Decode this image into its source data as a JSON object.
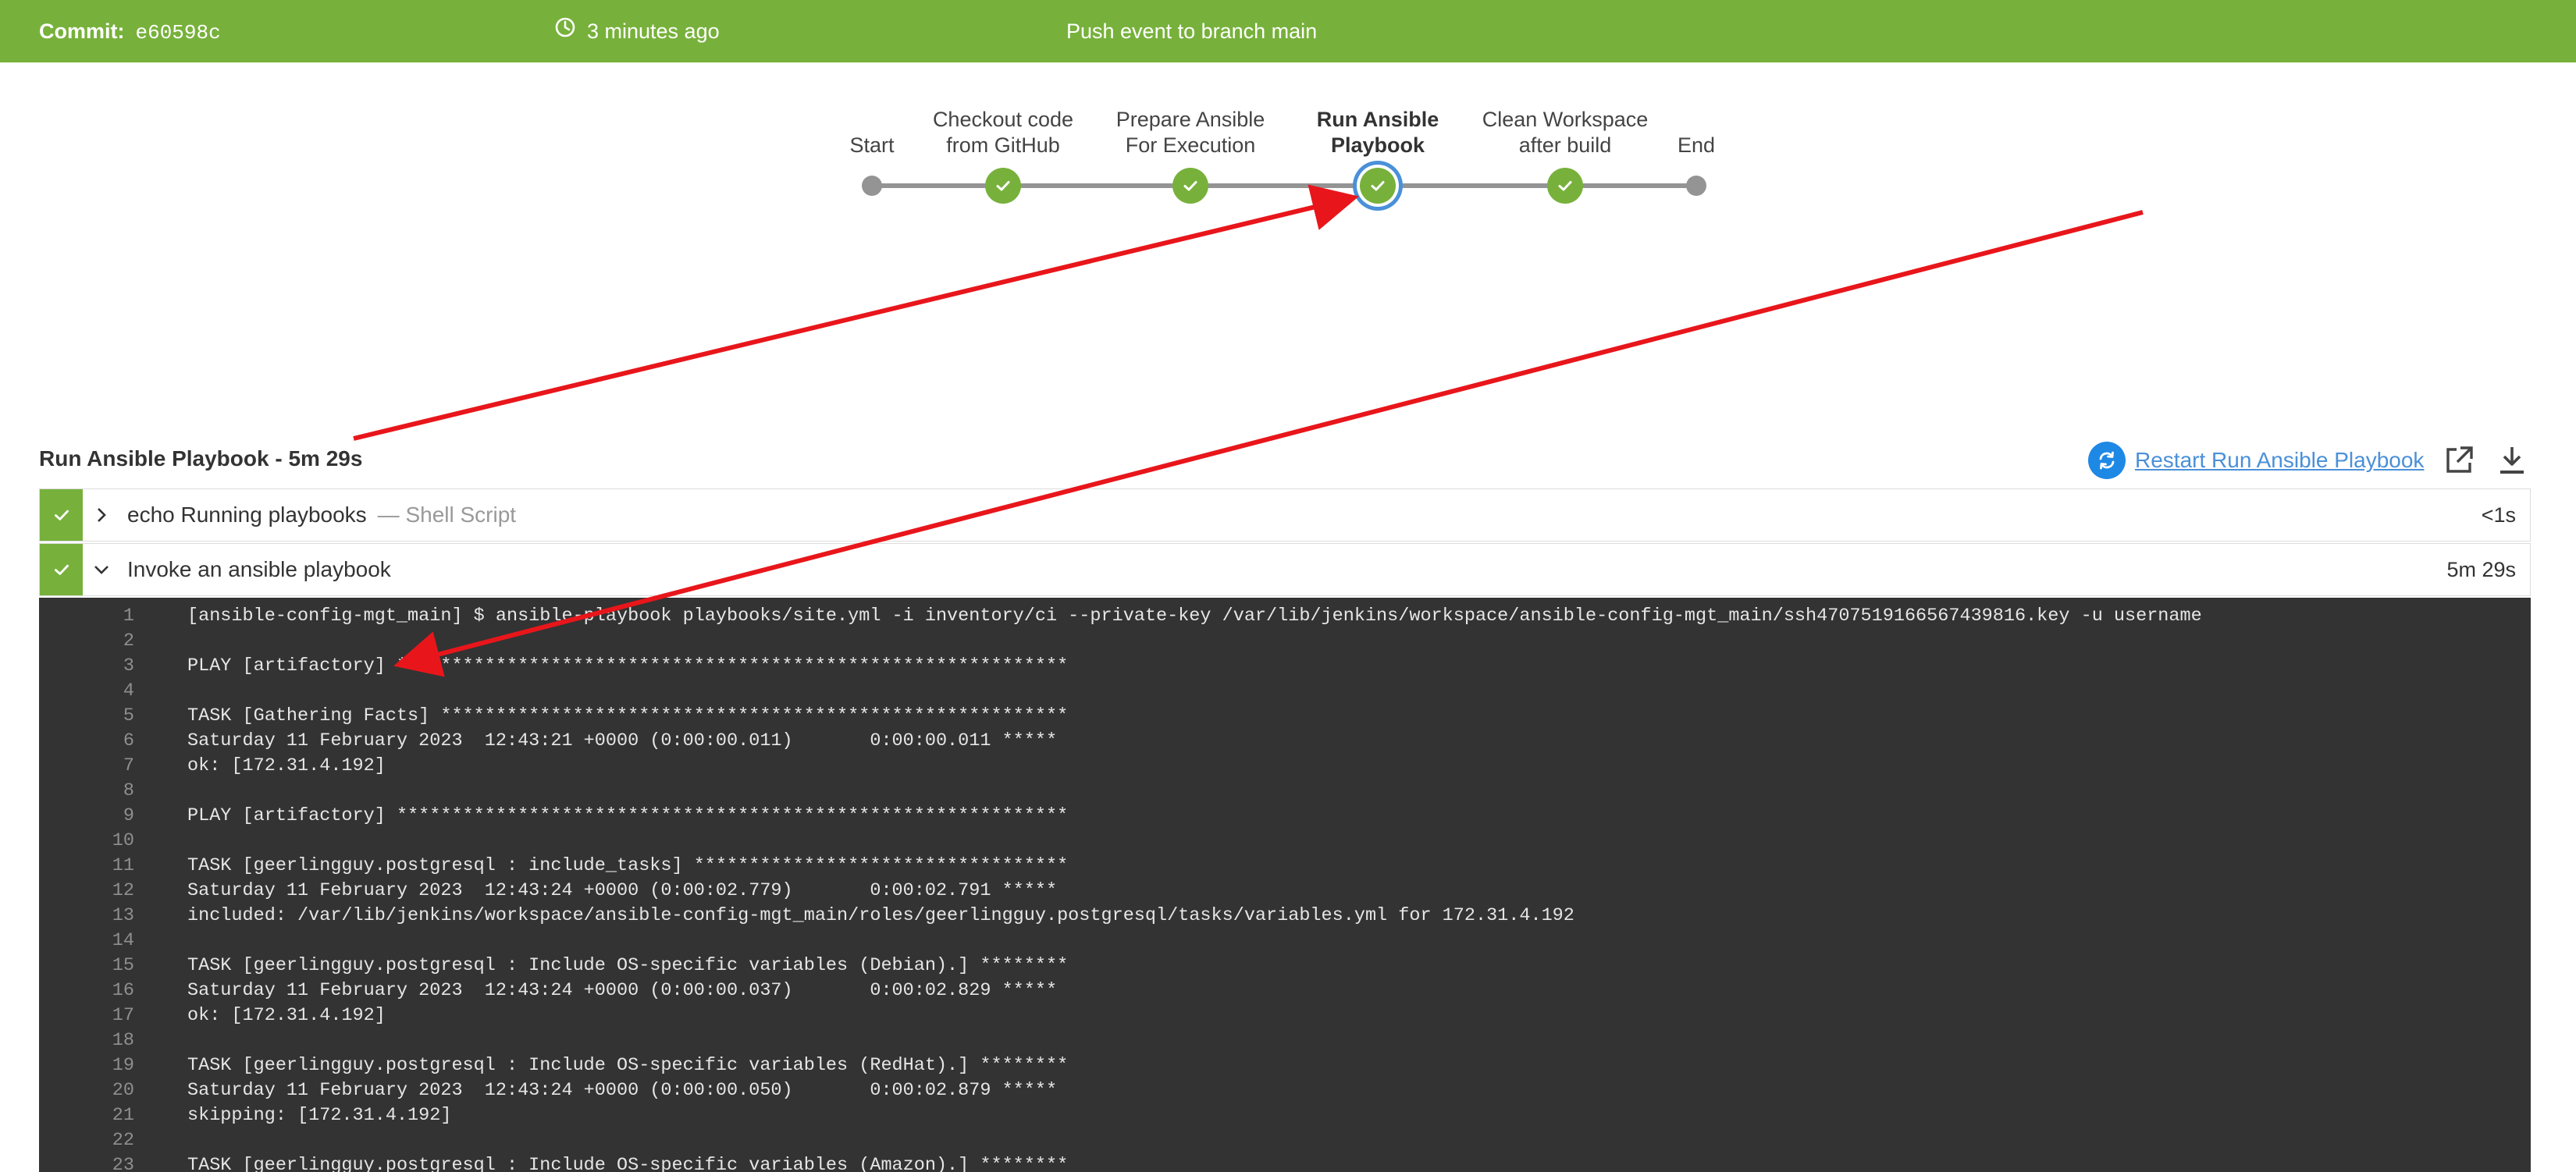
{
  "header": {
    "commit_label": "Commit:",
    "commit_hash": "e60598c",
    "time_ago": "3 minutes ago",
    "cause": "Push event to branch main"
  },
  "pipeline": {
    "stages": [
      {
        "label": "Start",
        "status": "start"
      },
      {
        "label": "Checkout code\nfrom GitHub",
        "status": "success"
      },
      {
        "label": "Prepare Ansible\nFor Execution",
        "status": "success"
      },
      {
        "label": "Run Ansible\nPlaybook",
        "status": "success",
        "selected": true
      },
      {
        "label": "Clean Workspace\nafter build",
        "status": "success"
      },
      {
        "label": "End",
        "status": "end"
      }
    ]
  },
  "stage_detail": {
    "title": "Run Ansible Playbook - 5m 29s",
    "restart_label": "Restart Run Ansible Playbook",
    "steps": [
      {
        "name": "echo Running playbooks",
        "type": "— Shell Script",
        "duration": "<1s",
        "expanded": false
      },
      {
        "name": "Invoke an ansible playbook",
        "type": "",
        "duration": "5m 29s",
        "expanded": true
      }
    ]
  },
  "log": [
    {
      "n": "1",
      "text": "[ansible-config-mgt_main] $ ansible-playbook playbooks/site.yml -i inventory/ci --private-key /var/lib/jenkins/workspace/ansible-config-mgt_main/ssh4707519166567439816.key -u username"
    },
    {
      "n": "2",
      "text": ""
    },
    {
      "n": "3",
      "text": "PLAY [artifactory] *************************************************************"
    },
    {
      "n": "4",
      "text": ""
    },
    {
      "n": "5",
      "text": "TASK [Gathering Facts] *********************************************************"
    },
    {
      "n": "6",
      "text": "Saturday 11 February 2023  12:43:21 +0000 (0:00:00.011)       0:00:00.011 *****"
    },
    {
      "n": "7",
      "text": "ok: [172.31.4.192]"
    },
    {
      "n": "8",
      "text": ""
    },
    {
      "n": "9",
      "text": "PLAY [artifactory] *************************************************************"
    },
    {
      "n": "10",
      "text": ""
    },
    {
      "n": "11",
      "text": "TASK [geerlingguy.postgresql : include_tasks] **********************************"
    },
    {
      "n": "12",
      "text": "Saturday 11 February 2023  12:43:24 +0000 (0:00:02.779)       0:00:02.791 *****"
    },
    {
      "n": "13",
      "text": "included: /var/lib/jenkins/workspace/ansible-config-mgt_main/roles/geerlingguy.postgresql/tasks/variables.yml for 172.31.4.192"
    },
    {
      "n": "14",
      "text": ""
    },
    {
      "n": "15",
      "text": "TASK [geerlingguy.postgresql : Include OS-specific variables (Debian).] ********"
    },
    {
      "n": "16",
      "text": "Saturday 11 February 2023  12:43:24 +0000 (0:00:00.037)       0:00:02.829 *****"
    },
    {
      "n": "17",
      "text": "ok: [172.31.4.192]"
    },
    {
      "n": "18",
      "text": ""
    },
    {
      "n": "19",
      "text": "TASK [geerlingguy.postgresql : Include OS-specific variables (RedHat).] ********"
    },
    {
      "n": "20",
      "text": "Saturday 11 February 2023  12:43:24 +0000 (0:00:00.050)       0:00:02.879 *****"
    },
    {
      "n": "21",
      "text": "skipping: [172.31.4.192]"
    },
    {
      "n": "22",
      "text": ""
    },
    {
      "n": "23",
      "text": "TASK [geerlingguy.postgresql : Include OS-specific variables (Amazon).] ********"
    }
  ],
  "colors": {
    "success": "#77b13b",
    "accent": "#4a90d9",
    "console_bg": "#333333",
    "annotation": "#e8161b"
  }
}
